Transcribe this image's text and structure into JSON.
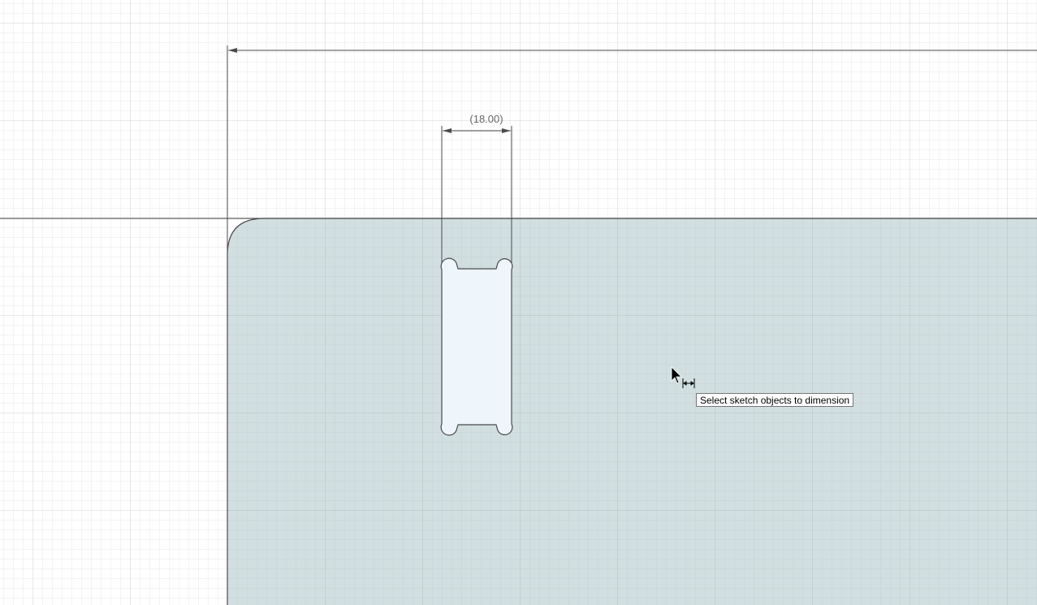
{
  "sketch": {
    "dimension_value": "(18.00)"
  },
  "tooltip": {
    "text": "Select sketch objects to dimension"
  },
  "colors": {
    "background": "#ffffff",
    "minor_grid": "#e6e6e6",
    "major_grid": "#cdcdcd",
    "profile_fill": "#d2dfe1",
    "slot_fill": "#eef5fb",
    "sketch_line": "#4a4a4a"
  },
  "cursor": {
    "pointer_icon": "arrow-pointer-icon",
    "tool_icon": "linear-dimension-icon"
  }
}
